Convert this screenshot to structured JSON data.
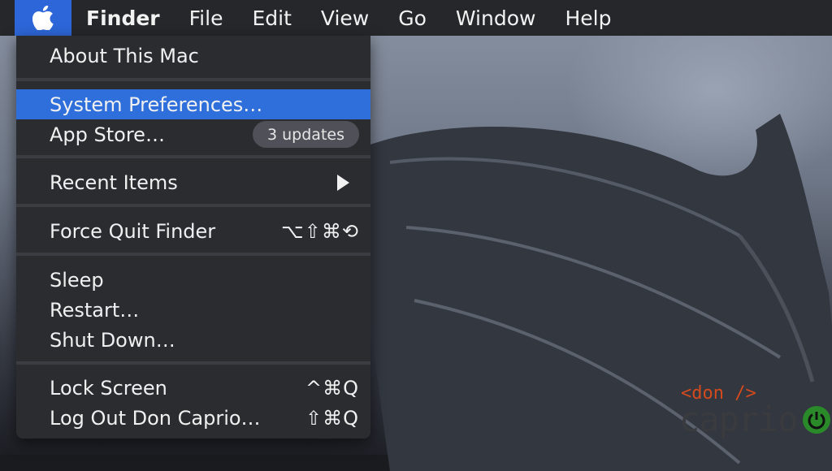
{
  "menubar": {
    "apple_icon": "apple-logo-icon",
    "items": [
      "Finder",
      "File",
      "Edit",
      "View",
      "Go",
      "Window",
      "Help"
    ]
  },
  "apple_menu": {
    "about": "About This Mac",
    "system_preferences": "System Preferences…",
    "app_store": "App Store…",
    "app_store_badge": "3 updates",
    "recent_items": "Recent Items",
    "force_quit": "Force Quit Finder",
    "force_quit_shortcut": "⌥⇧⌘⟲",
    "sleep": "Sleep",
    "restart": "Restart…",
    "shut_down": "Shut Down…",
    "lock_screen": "Lock Screen",
    "lock_screen_shortcut": "^⌘Q",
    "log_out": "Log Out Don Caprio…",
    "log_out_shortcut": "⇧⌘Q"
  },
  "watermark": {
    "code": "<don />",
    "name": "caprio"
  },
  "colors": {
    "highlight": "#2f6fdb",
    "menu_bg": "#2b2c30",
    "menubar_bg": "#26272b"
  }
}
